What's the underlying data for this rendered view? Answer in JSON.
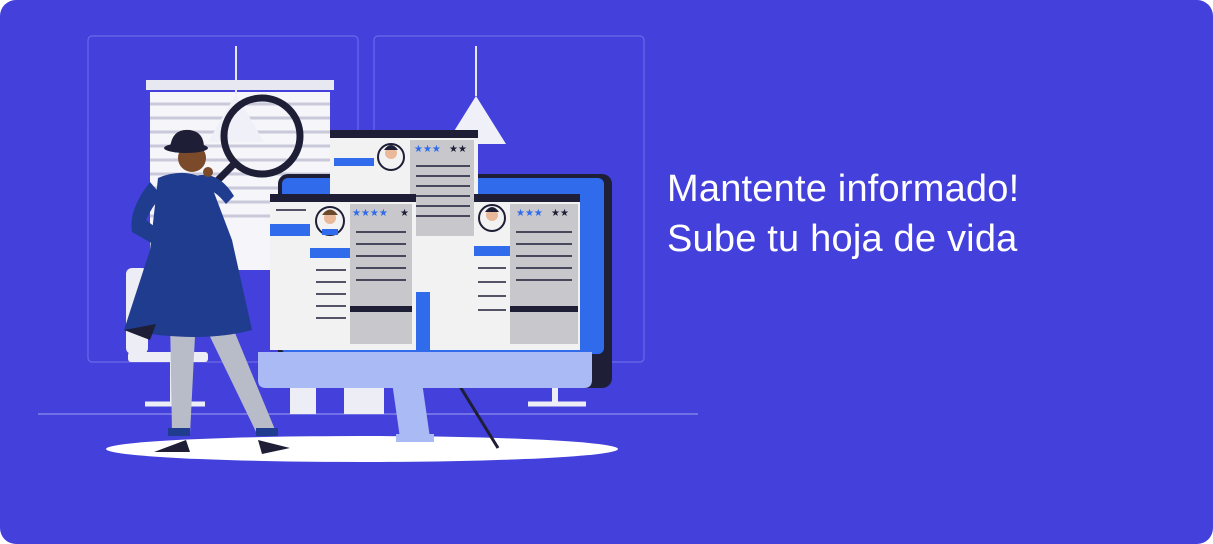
{
  "banner": {
    "headline_line1": "Mantente informado!",
    "headline_line2": "Sube tu hoja de vida",
    "background_color": "#4340DB",
    "text_color": "#FFFFFF"
  },
  "illustration": {
    "subject": "detective-with-magnifier-reviewing-resumes-on-monitor",
    "palette": {
      "monitor_frame": "#1E1E36",
      "monitor_screen": "#2F6BEA",
      "monitor_stand": "#A9BAF5",
      "card": "#F2F2F2",
      "card_accent": "#2F6BEA",
      "coat": "#1F3C8F",
      "trousers": "#B8BCC8",
      "star_active": "#2F6BEA",
      "star_inactive": "#1E1E36"
    }
  }
}
